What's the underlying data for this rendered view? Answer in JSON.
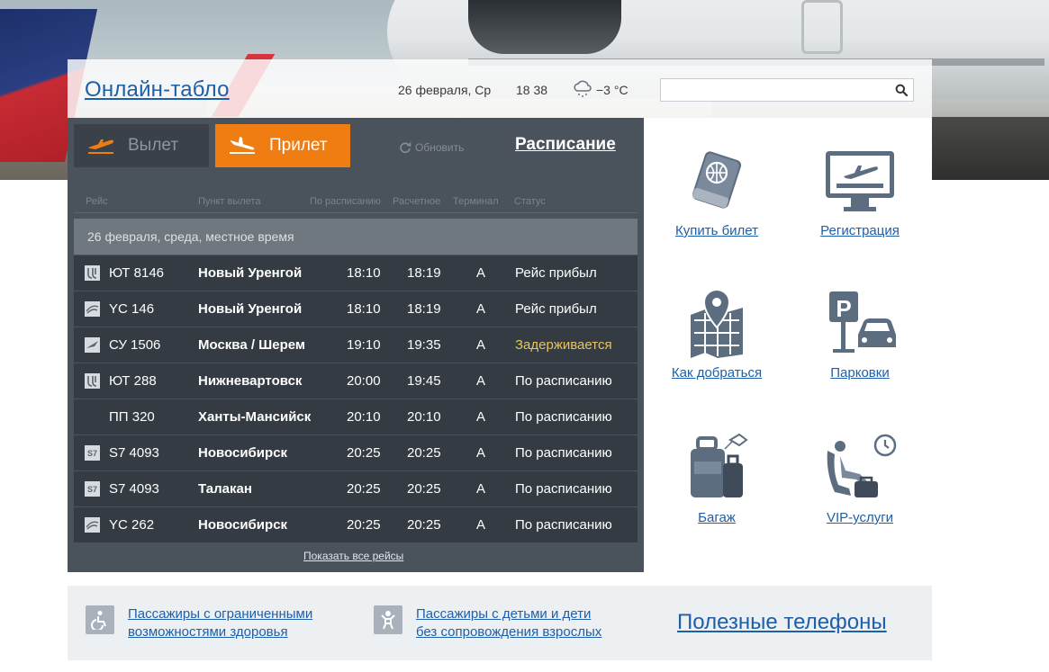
{
  "header": {
    "site_title": "Онлайн-табло",
    "date": "26 февраля, Ср",
    "time": "18 38",
    "weather_icon": "cloud-snow-icon",
    "temperature": "−3 °C",
    "search": {
      "value": "",
      "placeholder": ""
    }
  },
  "board": {
    "tabs": {
      "departure": "Вылет",
      "arrival": "Прилет",
      "active": "arrival"
    },
    "refresh_label": "Обновить",
    "schedule_link": "Расписание",
    "columns": [
      "Рейс",
      "Пункт вылета",
      "По расписанию",
      "Расчетное",
      "Терминал",
      "Статус"
    ],
    "date_header": "26 февраля, среда, местное время",
    "flights": [
      {
        "airline_logo": "utair-logo",
        "flight": "ЮТ 8146",
        "city": "Новый Уренгой",
        "scheduled": "18:10",
        "estimated": "18:19",
        "terminal": "A",
        "status": "Рейс прибыл",
        "status_type": "normal"
      },
      {
        "airline_logo": "yamal-logo",
        "flight": "YC 146",
        "city": "Новый Уренгой",
        "scheduled": "18:10",
        "estimated": "18:19",
        "terminal": "A",
        "status": "Рейс прибыл",
        "status_type": "normal"
      },
      {
        "airline_logo": "aeroflot-logo",
        "flight": "СУ 1506",
        "city": "Москва / Шерем",
        "scheduled": "19:10",
        "estimated": "19:35",
        "terminal": "A",
        "status": "Задерживается",
        "status_type": "delayed"
      },
      {
        "airline_logo": "utair-logo",
        "flight": "ЮТ 288",
        "city": "Нижневартовск",
        "scheduled": "20:00",
        "estimated": "19:45",
        "terminal": "A",
        "status": "По расписанию",
        "status_type": "normal"
      },
      {
        "airline_logo": "",
        "flight": "ПП 320",
        "city": "Ханты-Мансийск",
        "scheduled": "20:10",
        "estimated": "20:10",
        "terminal": "A",
        "status": "По расписанию",
        "status_type": "normal"
      },
      {
        "airline_logo": "s7-logo",
        "flight": "S7 4093",
        "city": "Новосибирск",
        "scheduled": "20:25",
        "estimated": "20:25",
        "terminal": "A",
        "status": "По расписанию",
        "status_type": "normal"
      },
      {
        "airline_logo": "s7-logo",
        "flight": "S7 4093",
        "city": "Талакан",
        "scheduled": "20:25",
        "estimated": "20:25",
        "terminal": "A",
        "status": "По расписанию",
        "status_type": "normal"
      },
      {
        "airline_logo": "yamal-logo",
        "flight": "YC 262",
        "city": "Новосибирск",
        "scheduled": "20:25",
        "estimated": "20:25",
        "terminal": "A",
        "status": "По расписанию",
        "status_type": "normal"
      }
    ],
    "show_all": "Показать все рейсы"
  },
  "services": {
    "buy_ticket": {
      "label": "Купить билет",
      "icon": "passport-ticket-icon"
    },
    "registration": {
      "label": "Регистрация",
      "icon": "checkin-monitor-icon"
    },
    "directions": {
      "label": "Как добраться",
      "icon": "map-pin-icon"
    },
    "parking": {
      "label": "Парковки",
      "icon": "parking-car-icon"
    },
    "baggage": {
      "label": "Багаж",
      "icon": "luggage-icon"
    },
    "vip": {
      "label": "VIP-услуги",
      "icon": "vip-seat-icon"
    }
  },
  "footer": {
    "disabled_line1": "Пассажиры с ограниченными",
    "disabled_line2": "возможностями здоровья",
    "children_line1": "Пассажиры с детьми и дети",
    "children_line2": "без сопровождения взрослых",
    "phones": "Полезные телефоны"
  },
  "colors": {
    "accent_orange": "#ef7d12",
    "link_blue": "#1e5fa8",
    "board_bg": "#4a525b",
    "row_bg": "#353b42",
    "delayed_yellow": "#e8c55a",
    "icon_slate": "#5d6d80"
  }
}
